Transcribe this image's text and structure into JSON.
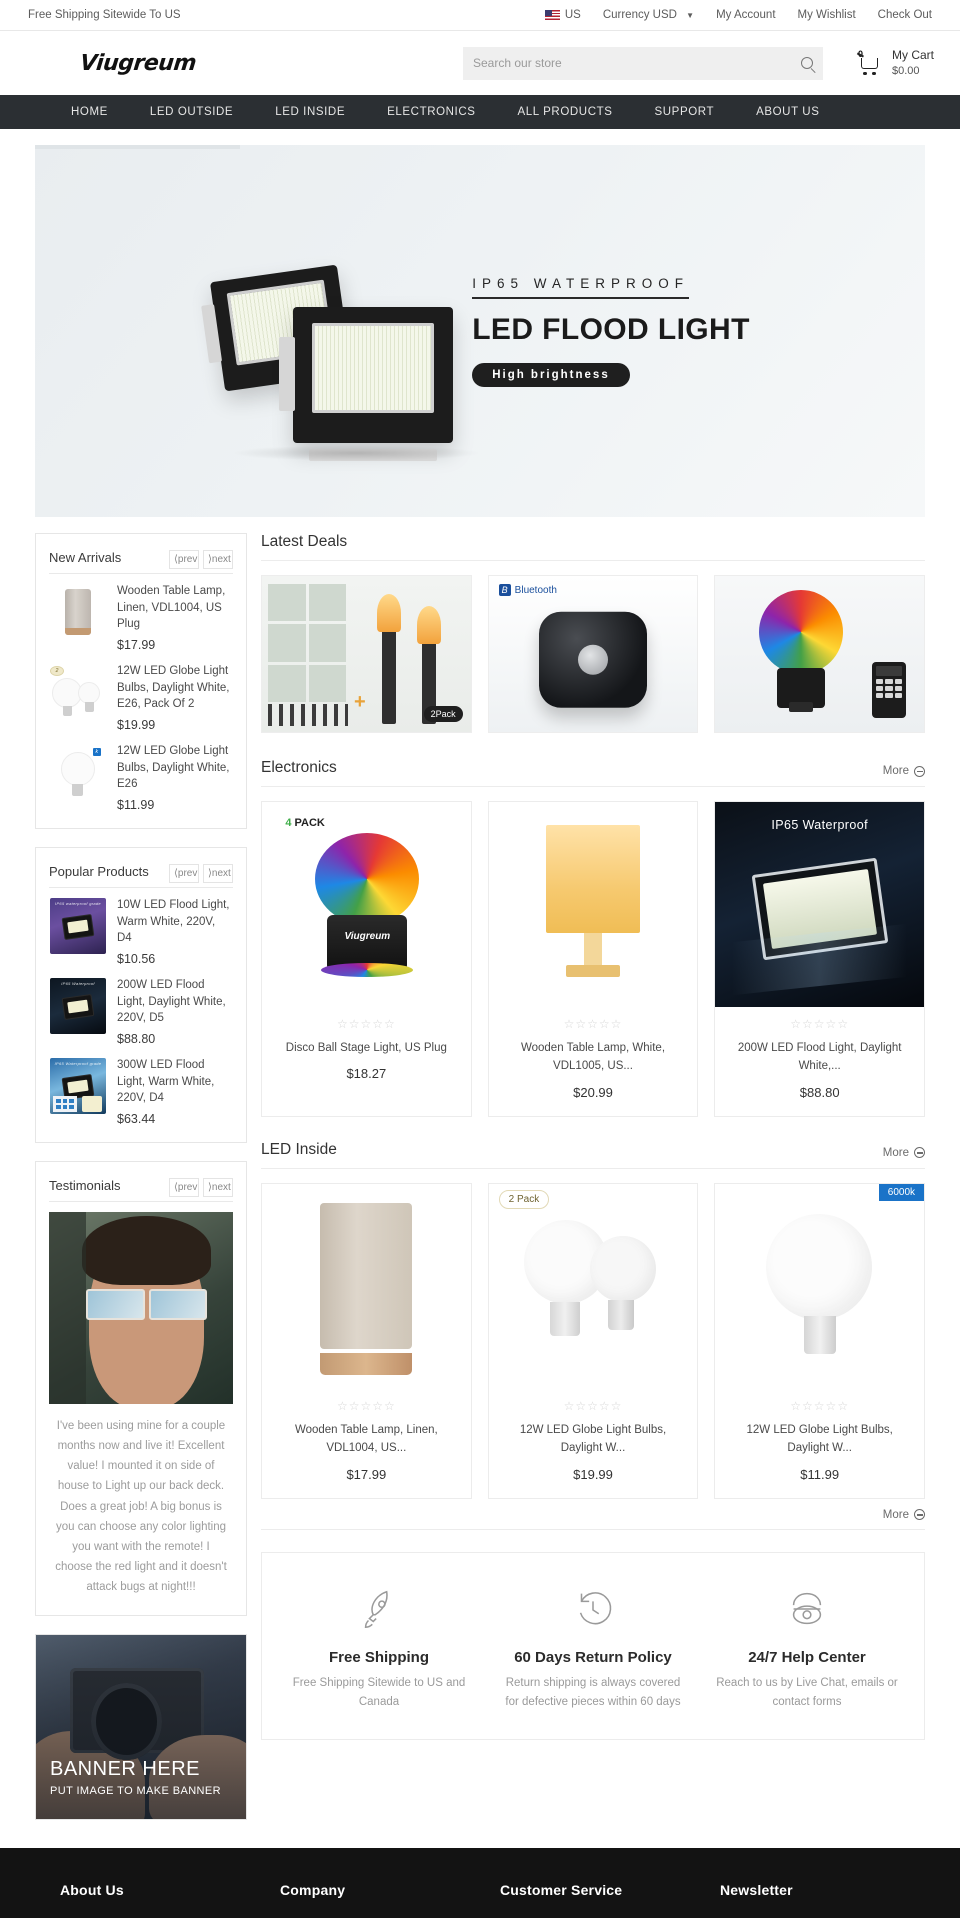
{
  "topbar": {
    "shipping": "Free Shipping Sitewide To US",
    "country": "US",
    "currency": "Currency USD",
    "links": [
      "My Account",
      "My Wishlist",
      "Check Out"
    ]
  },
  "header": {
    "logo": "Viugreum",
    "search_placeholder": "Search our store",
    "search_value": "",
    "cart_count": "0",
    "cart_label": "My Cart",
    "cart_total": "$0.00"
  },
  "nav": {
    "items": [
      "HOME",
      "LED OUTSIDE",
      "LED INSIDE",
      "ELECTRONICS",
      "ALL PRODUCTS",
      "SUPPORT",
      "ABOUT US"
    ]
  },
  "hero": {
    "kicker": "IP65 WATERPROOF",
    "title": "LED FLOOD LIGHT",
    "pill": "High brightness"
  },
  "sidebar": {
    "new_arrivals": {
      "title": "New Arrivals",
      "prev": "prev",
      "next": "next",
      "items": [
        {
          "name": "Wooden Table Lamp, Linen, VDL1004, US Plug",
          "price": "$17.99"
        },
        {
          "name": "12W LED Globe Light Bulbs, Daylight White, E26, Pack Of 2",
          "price": "$19.99"
        },
        {
          "name": "12W LED Globe Light Bulbs, Daylight White, E26",
          "price": "$11.99"
        }
      ]
    },
    "popular_products": {
      "title": "Popular Products",
      "prev": "prev",
      "next": "next",
      "items": [
        {
          "name": "10W LED Flood Light, Warm White, 220V, D4",
          "price": "$10.56"
        },
        {
          "name": "200W LED Flood Light, Daylight White, 220V, D5",
          "price": "$88.80"
        },
        {
          "name": "300W LED Flood Light, Warm White, 220V, D4",
          "price": "$63.44"
        }
      ]
    },
    "testimonials": {
      "title": "Testimonials",
      "prev": "prev",
      "next": "next",
      "text": "I've been using mine for a couple months now and live it! Excellent value! I mounted it on side of house to Light up our back deck. Does a great job! A big bonus is you can choose any color lighting you want with the remote! I choose the red light and it doesn't attack bugs at night!!!"
    },
    "banner": {
      "title": "BANNER HERE",
      "subtitle": "PUT IMAGE TO MAKE BANNER"
    }
  },
  "sections": {
    "latest_deals": {
      "title": "Latest Deals"
    },
    "electronics": {
      "title": "Electronics",
      "more": "More",
      "products": [
        {
          "name": "Disco Ball Stage Light, US Plug",
          "price": "$18.27",
          "rating": "☆☆☆☆☆"
        },
        {
          "name": "Wooden Table Lamp, White, VDL1005, US...",
          "price": "$20.99",
          "rating": "☆☆☆☆☆"
        },
        {
          "name": "200W LED Flood Light, Daylight White,...",
          "price": "$88.80",
          "rating": "☆☆☆☆☆"
        }
      ]
    },
    "led_inside": {
      "title": "LED Inside",
      "more": "More",
      "more_bottom": "More",
      "products": [
        {
          "name": "Wooden Table Lamp, Linen, VDL1004, US...",
          "price": "$17.99",
          "rating": "☆☆☆☆☆"
        },
        {
          "name": "12W LED Globe Light Bulbs, Daylight W...",
          "price": "$19.99",
          "rating": "☆☆☆☆☆",
          "badge": "2 Pack"
        },
        {
          "name": "12W LED Globe Light Bulbs, Daylight W...",
          "price": "$11.99",
          "rating": "☆☆☆☆☆",
          "badge": "6000k"
        }
      ]
    }
  },
  "deals_labels": {
    "bluetooth": "Bluetooth",
    "pack_2": "2Pack",
    "pack_4": "4 PACK",
    "pack_4_num": "4",
    "ip65": "IP65 Waterproof",
    "brand_on_product": "Viugreum"
  },
  "services": [
    {
      "icon": "rocket-icon",
      "title": "Free Shipping",
      "desc": "Free Shipping Sitewide to US and Canada"
    },
    {
      "icon": "clock-rewind-icon",
      "title": "60 Days Return Policy",
      "desc": "Return shipping is always covered for defective pieces within 60 days"
    },
    {
      "icon": "phone-icon",
      "title": "24/7 Help Center",
      "desc": "Reach to us by Live Chat, emails or contact forms"
    }
  ],
  "footer": {
    "columns": [
      "About Us",
      "Company",
      "Customer Service",
      "Newsletter"
    ]
  },
  "colors": {
    "nav_bg": "#2b2f33",
    "footer_bg": "#131313",
    "badge_blue": "#1a73c8",
    "accent_green": "#3fae49"
  }
}
